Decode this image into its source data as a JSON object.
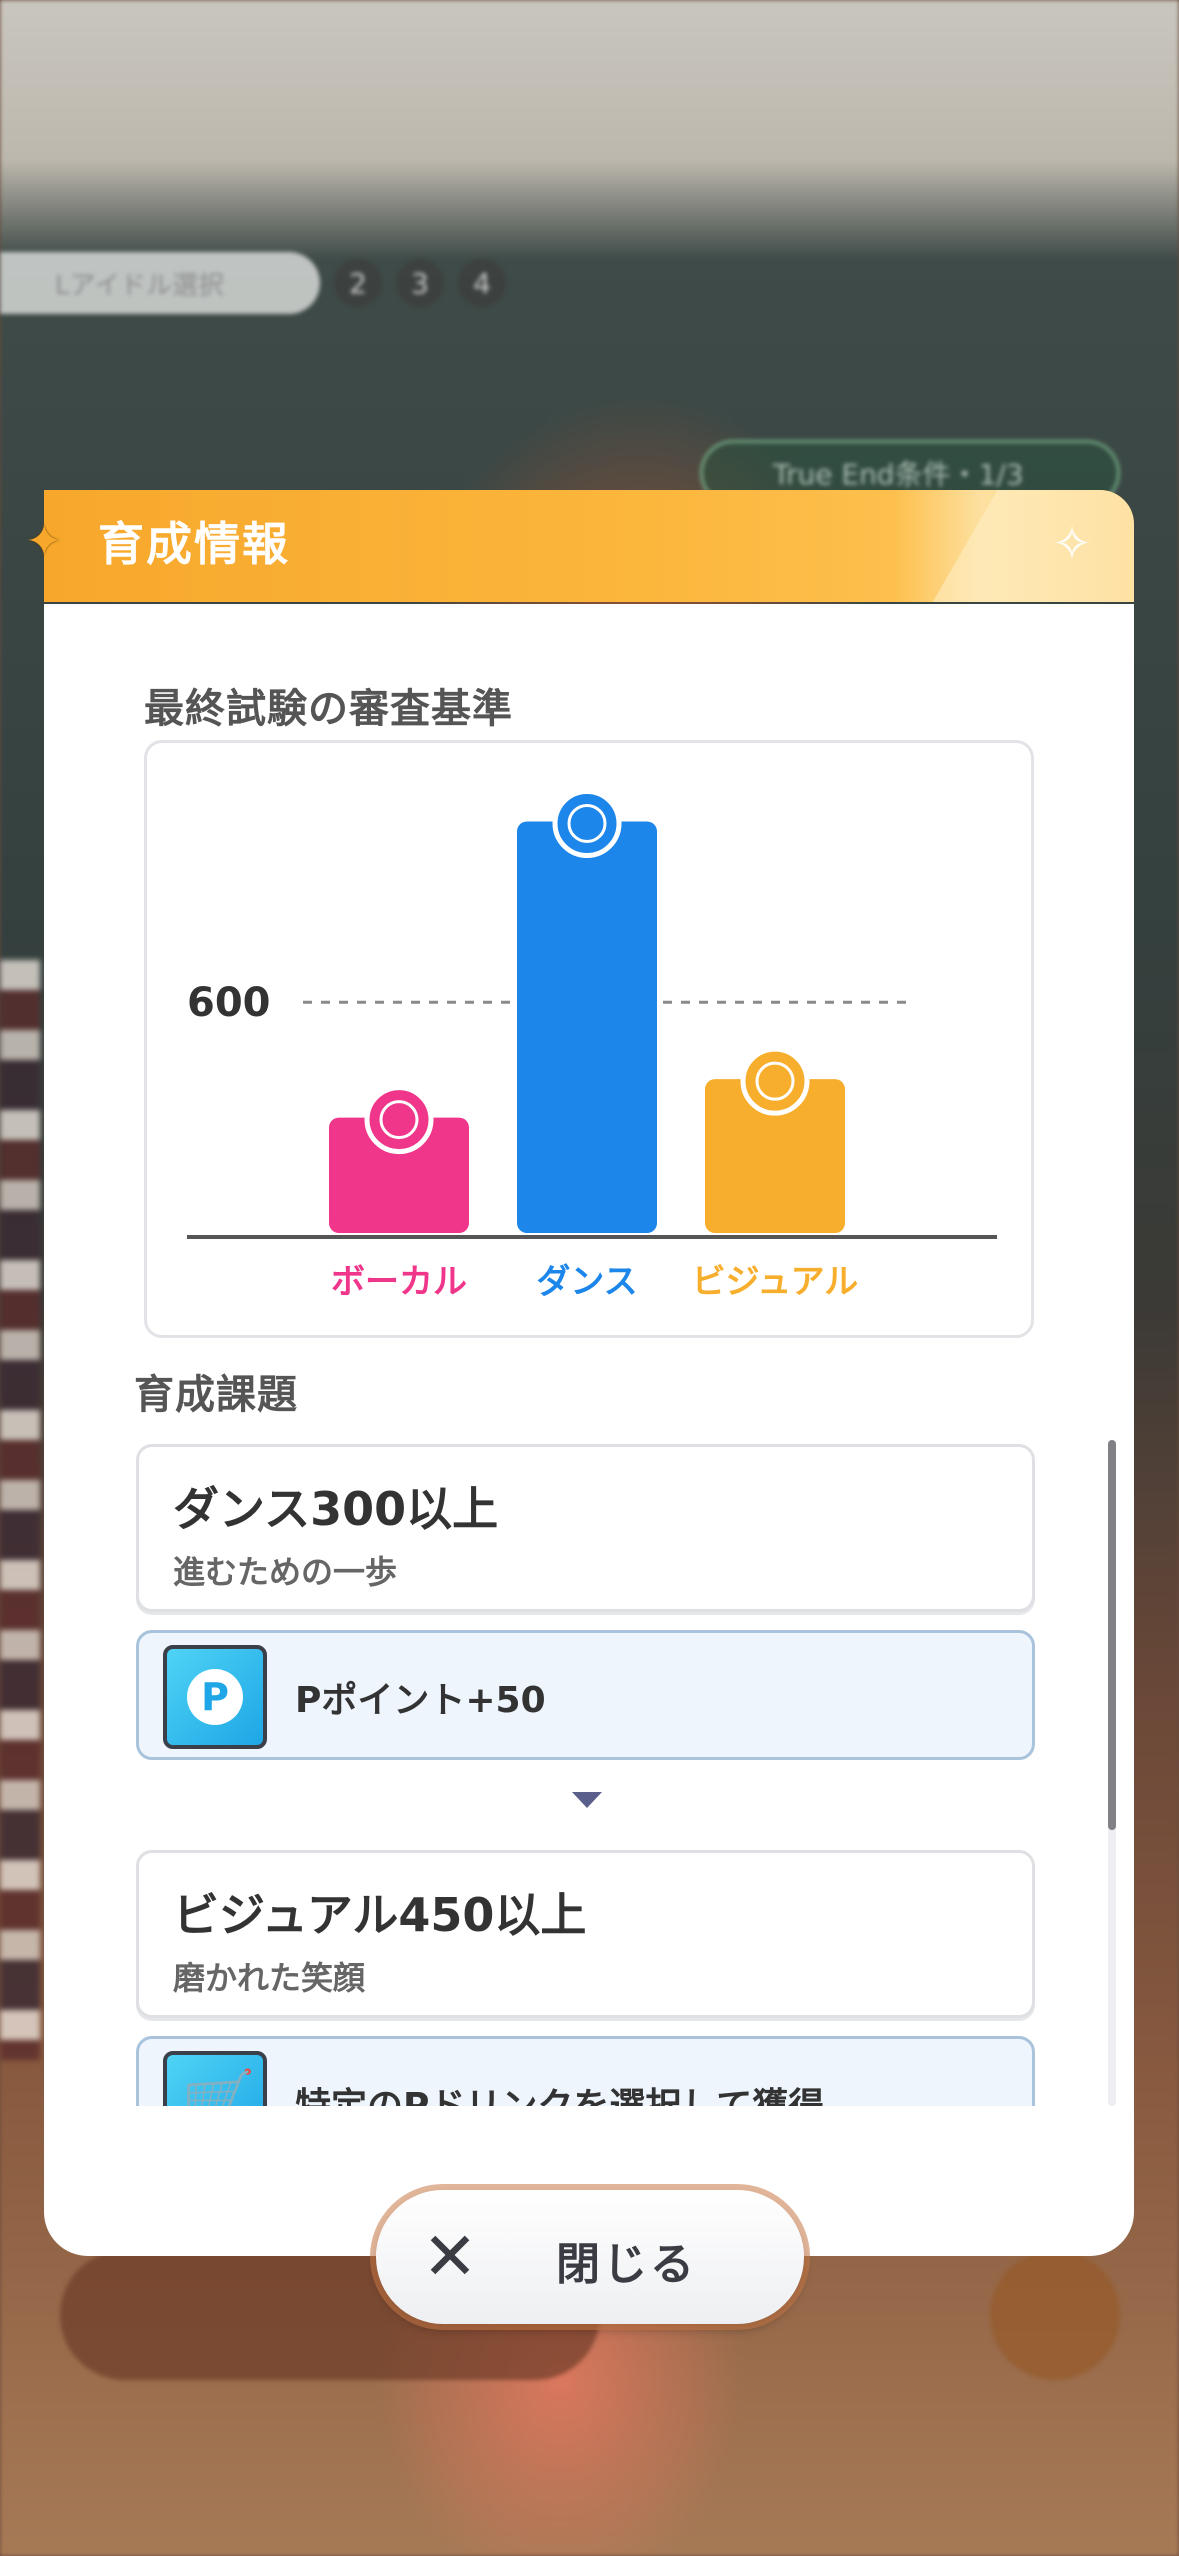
{
  "background": {
    "progress_label": "Lアイドル選択",
    "steps": [
      "2",
      "3",
      "4"
    ],
    "true_end_label": "True End条件・1/3"
  },
  "header": {
    "title": "育成情報",
    "accent_color": "#f7a82c"
  },
  "chart_section": {
    "label": "最終試験の審査基準"
  },
  "chart_data": {
    "type": "bar",
    "categories": [
      "ボーカル",
      "ダンス",
      "ビジュアル"
    ],
    "values": [
      300,
      1070,
      400
    ],
    "colors": [
      "#f0368a",
      "#1d86ea",
      "#f7ae2c"
    ],
    "icons": [
      "microphone-icon",
      "shoe-icon",
      "face-icon"
    ],
    "reference_line": 600,
    "reference_label": "600",
    "ylim": [
      0,
      1170
    ]
  },
  "tasks_section": {
    "label": "育成課題",
    "tasks": [
      {
        "title": "ダンス300以上",
        "subtitle": "進むための一歩",
        "reward": "Pポイント+50",
        "reward_icon": "p-point-icon"
      },
      {
        "title": "ビジュアル450以上",
        "subtitle": "磨かれた笑顔",
        "reward": "特定のPドリンクを選択して獲得",
        "reward_icon": "drink-cart-icon"
      }
    ]
  },
  "close_button": {
    "label": "閉じる"
  }
}
